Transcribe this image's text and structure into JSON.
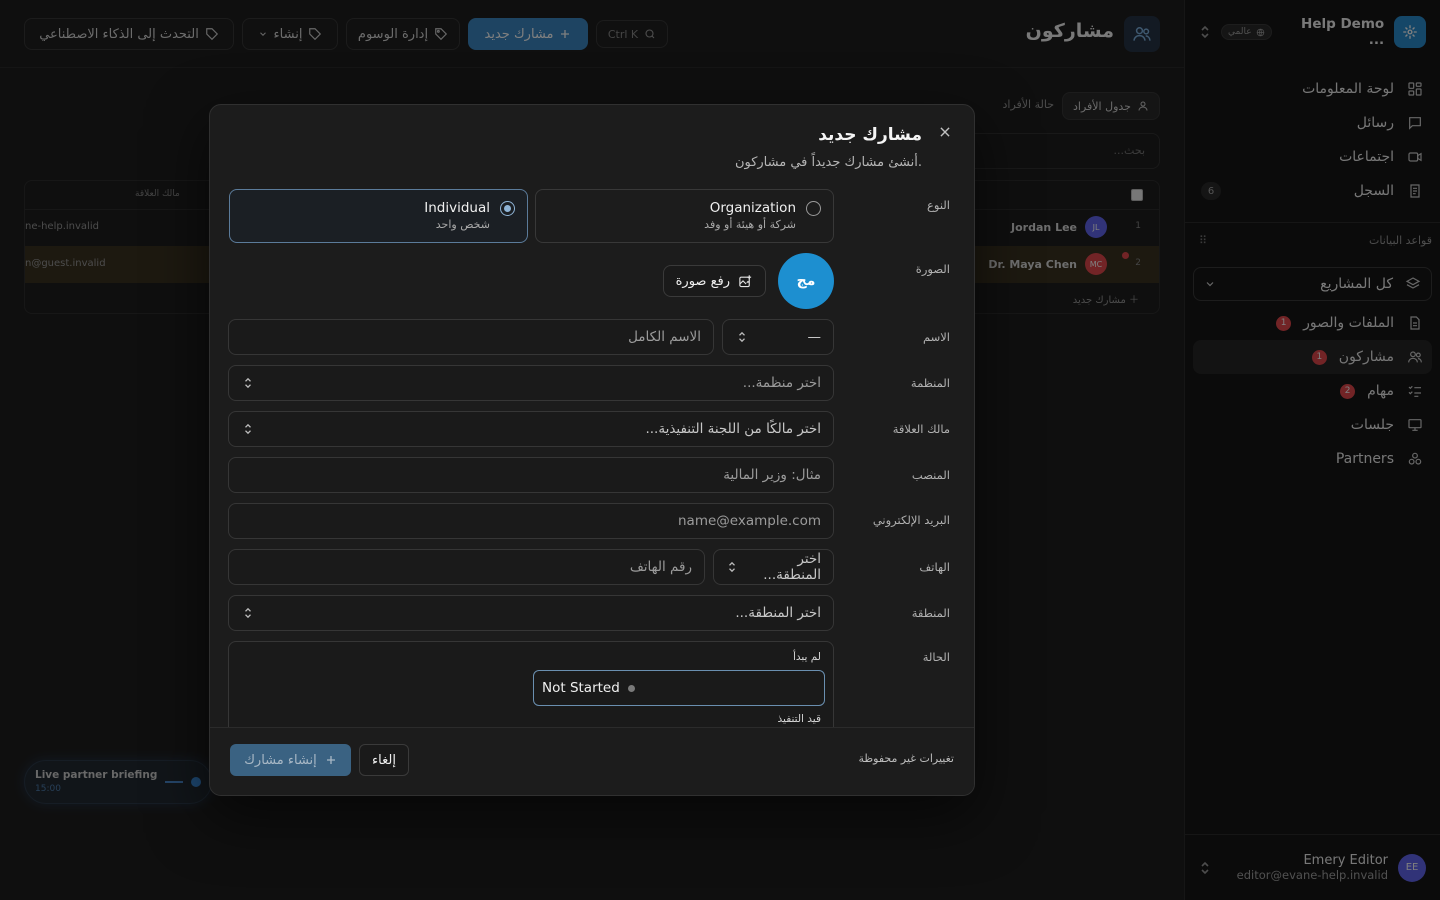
{
  "app": {
    "name": "Help Demo ...",
    "scope_badge": "عالمي",
    "nav": [
      {
        "label": "لوحة المعلومات",
        "icon": "grid-icon"
      },
      {
        "label": "رسائل",
        "icon": "message-icon"
      },
      {
        "label": "اجتماعات",
        "icon": "video-icon"
      },
      {
        "label": "السجل",
        "icon": "log-icon",
        "count": "6"
      }
    ],
    "databases_label": "قواعد البيانات",
    "project_select": "كل المشاريع",
    "databases": [
      {
        "label": "الملفات والصور",
        "icon": "file-icon",
        "badge": "1"
      },
      {
        "label": "مشاركون",
        "icon": "users-icon",
        "badge": "1",
        "active": true
      },
      {
        "label": "مهام",
        "icon": "tasks-icon",
        "badge": "2"
      },
      {
        "label": "جلسات",
        "icon": "presentation-icon"
      },
      {
        "label": "Partners",
        "icon": "partners-icon"
      }
    ],
    "user": {
      "initials": "EE",
      "name": "Emery Editor",
      "email": "editor@evane-help.invalid"
    }
  },
  "topbar": {
    "title": "مشاركون",
    "search_shortcut": "Ctrl K",
    "new_participant": "مشارك جديد",
    "manage_tags": "إدارة الوسوم",
    "create": "إنشاء",
    "talk_ai": "التحدث إلى الذكاء الاصطناعي"
  },
  "background": {
    "tabs": [
      "جدول الأفراد",
      "حالة الأفراد"
    ],
    "search_placeholder": "بحث...",
    "column_owner": "مالك العلاقة",
    "rows": [
      {
        "index": "1",
        "name": "Jordan Lee",
        "initials": "JL",
        "email": "ne-help.invalid"
      },
      {
        "index": "2",
        "name": "Dr. Maya Chen",
        "initials": "MC",
        "email": "n@guest.invalid"
      }
    ],
    "add_row": "مشارك جديد"
  },
  "toast": {
    "title": "Live partner briefing",
    "time": "15:00"
  },
  "modal": {
    "title": "مشارك جديد",
    "subtitle": "أنشئ مشارك جديداً في مشاركون.",
    "labels": {
      "type": "النوع",
      "photo": "الصورة",
      "name": "الاسم",
      "organization": "المنظمة",
      "owner": "مالك العلاقة",
      "position": "المنصب",
      "email": "البريد الإلكتروني",
      "phone": "الهاتف",
      "region": "المنطقة",
      "status": "الحالة"
    },
    "type_options": [
      {
        "title": "Individual",
        "desc": "شخص واحد",
        "selected": true
      },
      {
        "title": "Organization",
        "desc": "شركة أو هيئة أو وفد",
        "selected": false
      }
    ],
    "photo_initials": "مج",
    "upload_label": "رفع صورة",
    "prefix_value": "—",
    "placeholders": {
      "full_name": "الاسم الكامل",
      "organization": "اختر منظمة...",
      "owner": "اختر مالكًا من اللجنة التنفيذية...",
      "position": "مثال: وزير المالية",
      "email": "name@example.com",
      "phone_region": "اختر المنطقة...",
      "phone": "رقم الهاتف",
      "region": "اختر المنطقة..."
    },
    "status": {
      "group_not_started": "لم يبدأ",
      "selected_option": "Not Started",
      "group_in_progress": "قيد التنفيذ"
    },
    "footer": {
      "unsaved": "تغييرات غير محفوظة",
      "cancel": "إلغاء",
      "create": "إنشاء مشارك"
    }
  },
  "colors": {
    "accent": "#2b8fd1",
    "badge_red": "#e5484d",
    "avatar_purple": "#6366f1"
  }
}
